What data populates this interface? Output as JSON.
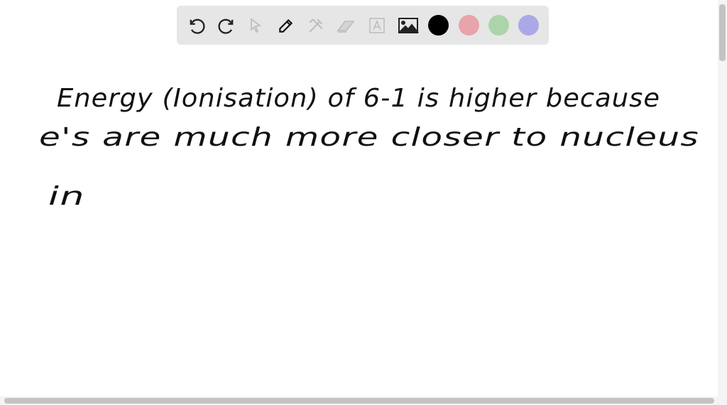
{
  "toolbar": {
    "tools": [
      "undo-icon",
      "redo-icon",
      "select-icon",
      "pen-icon",
      "tools-icon",
      "eraser-icon",
      "text-icon",
      "image-icon"
    ],
    "colors": {
      "black": "#000000",
      "red": "#e8a3ab",
      "green": "#acd4aa",
      "purple": "#aaa8e6"
    }
  },
  "board": {
    "lines": [
      "Energy (Ionisation) of 6-1 is higher because",
      "e's are much more closer to nucleus",
      "in"
    ]
  }
}
